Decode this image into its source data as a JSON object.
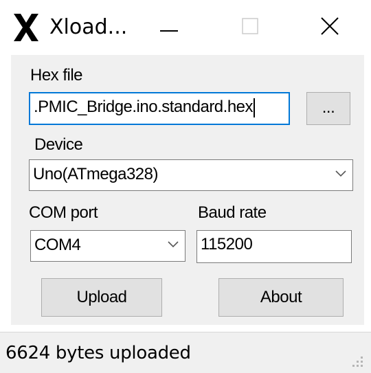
{
  "window": {
    "title": "Xload...",
    "icons": {
      "app": "x-logo-icon",
      "minimize": "minimize-icon",
      "maximize": "maximize-icon",
      "close": "close-icon"
    }
  },
  "form": {
    "hex_label": "Hex file",
    "hex_value": ".PMIC_Bridge.ino.standard.hex",
    "browse_label": "...",
    "device_label": "Device",
    "device_value": "Uno(ATmega328)",
    "com_label": "COM port",
    "com_value": "COM4",
    "baud_label": "Baud rate",
    "baud_value": "115200",
    "upload_label": "Upload",
    "about_label": "About"
  },
  "status": {
    "text": "6624 bytes uploaded"
  },
  "colors": {
    "focus_border": "#0078d7",
    "client_bg": "#f0f0f0",
    "button_bg": "#e1e1e1"
  }
}
